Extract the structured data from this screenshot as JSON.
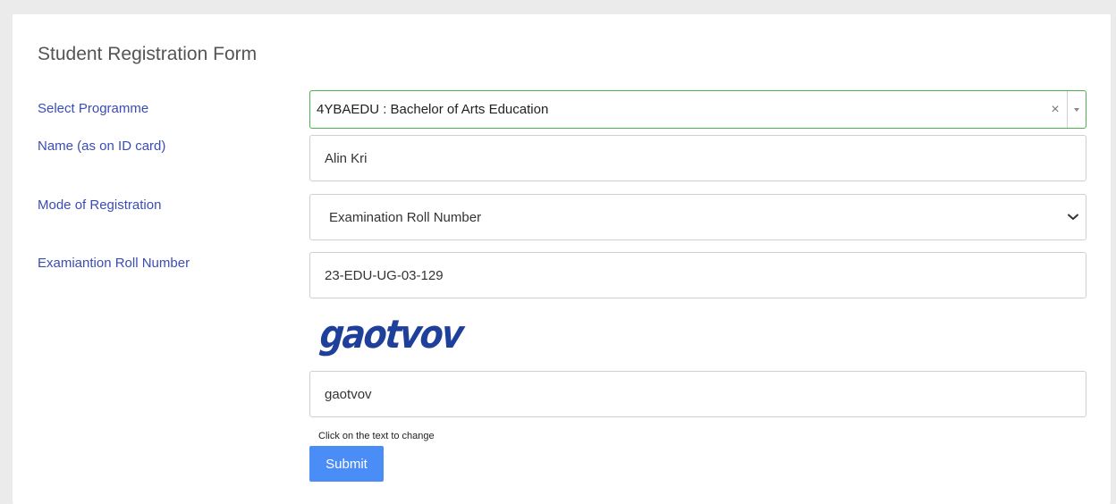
{
  "form": {
    "title": "Student Registration Form",
    "programme": {
      "label": "Select Programme",
      "selected": "4YBAEDU : Bachelor of Arts Education",
      "clear_glyph": "×"
    },
    "name": {
      "label": "Name (as on ID card)",
      "value": "Alin Kri"
    },
    "mode": {
      "label": "Mode of Registration",
      "selected": "Examination Roll Number"
    },
    "roll": {
      "label": "Examiantion Roll Number",
      "value": "23-EDU-UG-03-129"
    },
    "captcha": {
      "image_text": "gaotvov",
      "input_value": "gaotvov",
      "hint": "Click on the text to change"
    },
    "submit_label": "Submit"
  },
  "colors": {
    "label": "#3a4db5",
    "select_focus_border": "#4caf50",
    "submit_bg": "#4a8df6",
    "captcha": "#1e3f9a"
  },
  "icons": {
    "clear": "close-icon",
    "select_arrow": "caret-down-icon",
    "dropdown_arrow": "chevron-down-icon"
  }
}
